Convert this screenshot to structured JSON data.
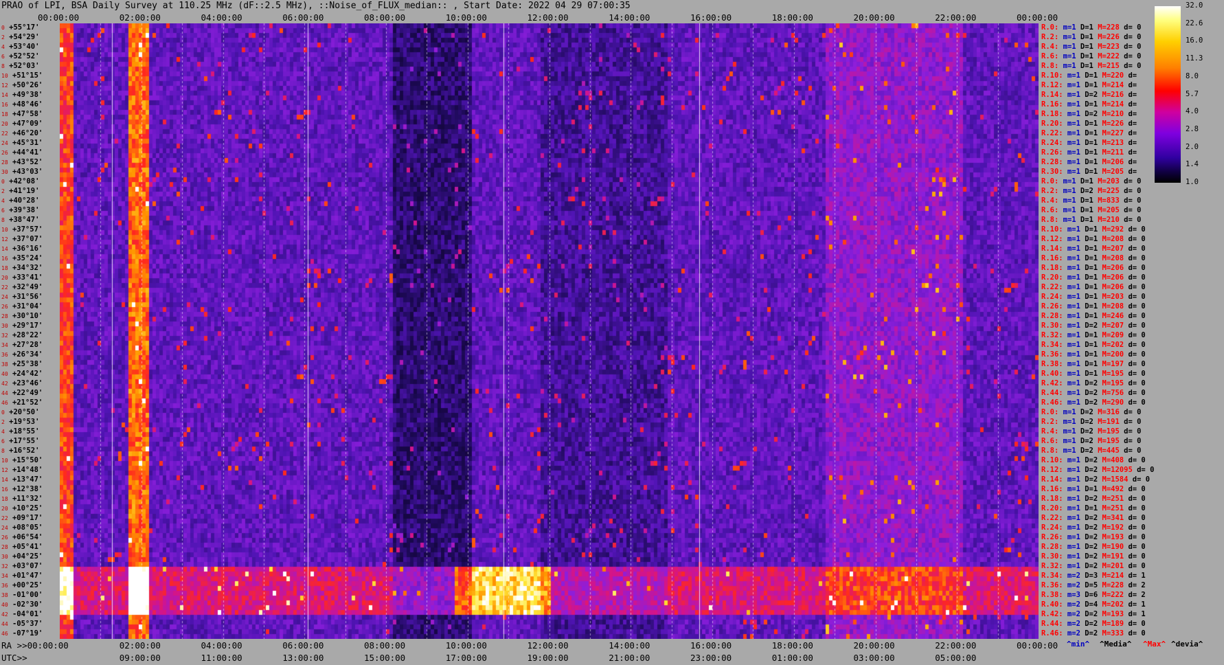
{
  "title": "PRAO of LPI, BSA Daily Survey at 110.25 MHz (dF::2.5 MHz), ::Noise_of_FLUX_median:: , Start Date: 2022 04 29 07:00:35",
  "chart_data": {
    "type": "heatmap",
    "title": "PRAO of LPI, BSA Daily Survey at 110.25 MHz (dF::2.5 MHz), ::Noise_of_FLUX_median:: , Start Date: 2022 04 29 07:00:35",
    "top_axis_ticks": [
      "00:00:00",
      "02:00:00",
      "04:00:00",
      "06:00:00",
      "08:00:00",
      "10:00:00",
      "12:00:00",
      "14:00:00",
      "16:00:00",
      "18:00:00",
      "20:00:00",
      "22:00:00",
      "00:00:00"
    ],
    "ra_axis_label": "RA >>00:00:00",
    "ra_axis_ticks": [
      "02:00:00",
      "04:00:00",
      "06:00:00",
      "08:00:00",
      "10:00:00",
      "12:00:00",
      "14:00:00",
      "16:00:00",
      "18:00:00",
      "20:00:00",
      "22:00:00",
      "00:00:00"
    ],
    "utc_axis_label": "UTC>>",
    "utc_axis_ticks": [
      "09:00:00",
      "11:00:00",
      "13:00:00",
      "15:00:00",
      "17:00:00",
      "19:00:00",
      "21:00:00",
      "23:00:00",
      "01:00:00",
      "03:00:00",
      "05:00:00"
    ],
    "colorbar_ticks": [
      "32.0",
      "22.6",
      "16.0",
      "11.3",
      "8.0",
      "5.7",
      "4.0",
      "2.8",
      "2.0",
      "1.4",
      "1.0"
    ],
    "dec_labels": [
      "+55°17'",
      "+54°29'",
      "+53°40'",
      "+52°52'",
      "+52°03'",
      "+51°15'",
      "+50°26'",
      "+49°38'",
      "+48°46'",
      "+47°58'",
      "+47°09'",
      "+46°20'",
      "+45°31'",
      "+44°41'",
      "+43°52'",
      "+43°03'",
      "+42°08'",
      "+41°19'",
      "+40°28'",
      "+39°38'",
      "+38°47'",
      "+37°57'",
      "+37°07'",
      "+36°16'",
      "+35°24'",
      "+34°32'",
      "+33°41'",
      "+32°49'",
      "+31°56'",
      "+31°04'",
      "+30°10'",
      "+29°17'",
      "+28°22'",
      "+27°28'",
      "+26°34'",
      "+25°38'",
      "+24°42'",
      "+23°46'",
      "+22°49'",
      "+21°52'",
      "+20°50'",
      "+19°53'",
      "+18°55'",
      "+17°55'",
      "+16°52'",
      "+15°50'",
      "+14°48'",
      "+13°47'",
      "+12°38'",
      "+11°32'",
      "+10°25'",
      "+09°17'",
      "+08°05'",
      "+06°54'",
      "+05°41'",
      "+04°25'",
      "+03°07'",
      "+01°47'",
      "+00°25'",
      "-01°00'",
      "-02°30'",
      "-04°01'",
      "-05°37'",
      "-07°19'"
    ],
    "row_numbers": [
      "0",
      "2",
      "4",
      "6",
      "8",
      "10",
      "12",
      "14",
      "16",
      "18",
      "20",
      "22",
      "24",
      "26",
      "28",
      "30",
      "0",
      "2",
      "4",
      "6",
      "8",
      "10",
      "12",
      "14",
      "16",
      "18",
      "20",
      "22",
      "24",
      "26",
      "28",
      "30",
      "32",
      "34",
      "36",
      "38",
      "40",
      "42",
      "44",
      "46",
      "0",
      "2",
      "4",
      "6",
      "8",
      "10",
      "12",
      "14",
      "16",
      "18",
      "20",
      "22",
      "24",
      "26",
      "28",
      "30",
      "32",
      "34",
      "36",
      "38",
      "40",
      "42",
      "44",
      "46"
    ],
    "stats": [
      {
        "r": "R.0:",
        "m": "m=1",
        "D": "D=1",
        "M": "M=228",
        "d": "d= 0"
      },
      {
        "r": "R.2:",
        "m": "m=1",
        "D": "D=1",
        "M": "M=226",
        "d": "d= 0"
      },
      {
        "r": "R.4:",
        "m": "m=1",
        "D": "D=1",
        "M": "M=223",
        "d": "d= 0"
      },
      {
        "r": "R.6:",
        "m": "m=1",
        "D": "D=1",
        "M": "M=222",
        "d": "d= 0"
      },
      {
        "r": "R.8:",
        "m": "m=1",
        "D": "D=1",
        "M": "M=215",
        "d": "d= 0"
      },
      {
        "r": "R.10:",
        "m": "m=1",
        "D": "D=1",
        "M": "M=220",
        "d": "d="
      },
      {
        "r": "R.12:",
        "m": "m=1",
        "D": "D=1",
        "M": "M=214",
        "d": "d="
      },
      {
        "r": "R.14:",
        "m": "m=1",
        "D": "D=2",
        "M": "M=216",
        "d": "d="
      },
      {
        "r": "R.16:",
        "m": "m=1",
        "D": "D=1",
        "M": "M=214",
        "d": "d="
      },
      {
        "r": "R.18:",
        "m": "m=1",
        "D": "D=2",
        "M": "M=210",
        "d": "d="
      },
      {
        "r": "R.20:",
        "m": "m=1",
        "D": "D=1",
        "M": "M=226",
        "d": "d="
      },
      {
        "r": "R.22:",
        "m": "m=1",
        "D": "D=1",
        "M": "M=227",
        "d": "d="
      },
      {
        "r": "R.24:",
        "m": "m=1",
        "D": "D=1",
        "M": "M=213",
        "d": "d="
      },
      {
        "r": "R.26:",
        "m": "m=1",
        "D": "D=1",
        "M": "M=211",
        "d": "d="
      },
      {
        "r": "R.28:",
        "m": "m=1",
        "D": "D=1",
        "M": "M=206",
        "d": "d="
      },
      {
        "r": "R.30:",
        "m": "m=1",
        "D": "D=1",
        "M": "M=205",
        "d": "d="
      },
      {
        "r": "R.0:",
        "m": "m=1",
        "D": "D=1",
        "M": "M=203",
        "d": "d= 0"
      },
      {
        "r": "R.2:",
        "m": "m=1",
        "D": "D=2",
        "M": "M=225",
        "d": "d= 0"
      },
      {
        "r": "R.4:",
        "m": "m=1",
        "D": "D=1",
        "M": "M=833",
        "d": "d= 0"
      },
      {
        "r": "R.6:",
        "m": "m=1",
        "D": "D=1",
        "M": "M=205",
        "d": "d= 0"
      },
      {
        "r": "R.8:",
        "m": "m=1",
        "D": "D=1",
        "M": "M=210",
        "d": "d= 0"
      },
      {
        "r": "R.10:",
        "m": "m=1",
        "D": "D=1",
        "M": "M=292",
        "d": "d= 0"
      },
      {
        "r": "R.12:",
        "m": "m=1",
        "D": "D=1",
        "M": "M=208",
        "d": "d= 0"
      },
      {
        "r": "R.14:",
        "m": "m=1",
        "D": "D=1",
        "M": "M=207",
        "d": "d= 0"
      },
      {
        "r": "R.16:",
        "m": "m=1",
        "D": "D=1",
        "M": "M=208",
        "d": "d= 0"
      },
      {
        "r": "R.18:",
        "m": "m=1",
        "D": "D=1",
        "M": "M=206",
        "d": "d= 0"
      },
      {
        "r": "R.20:",
        "m": "m=1",
        "D": "D=1",
        "M": "M=206",
        "d": "d= 0"
      },
      {
        "r": "R.22:",
        "m": "m=1",
        "D": "D=1",
        "M": "M=206",
        "d": "d= 0"
      },
      {
        "r": "R.24:",
        "m": "m=1",
        "D": "D=1",
        "M": "M=203",
        "d": "d= 0"
      },
      {
        "r": "R.26:",
        "m": "m=1",
        "D": "D=1",
        "M": "M=208",
        "d": "d= 0"
      },
      {
        "r": "R.28:",
        "m": "m=1",
        "D": "D=1",
        "M": "M=246",
        "d": "d= 0"
      },
      {
        "r": "R.30:",
        "m": "m=1",
        "D": "D=2",
        "M": "M=207",
        "d": "d= 0"
      },
      {
        "r": "R.32:",
        "m": "m=1",
        "D": "D=1",
        "M": "M=209",
        "d": "d= 0"
      },
      {
        "r": "R.34:",
        "m": "m=1",
        "D": "D=1",
        "M": "M=202",
        "d": "d= 0"
      },
      {
        "r": "R.36:",
        "m": "m=1",
        "D": "D=1",
        "M": "M=200",
        "d": "d= 0"
      },
      {
        "r": "R.38:",
        "m": "m=1",
        "D": "D=1",
        "M": "M=197",
        "d": "d= 0"
      },
      {
        "r": "R.40:",
        "m": "m=1",
        "D": "D=1",
        "M": "M=195",
        "d": "d= 0"
      },
      {
        "r": "R.42:",
        "m": "m=1",
        "D": "D=2",
        "M": "M=195",
        "d": "d= 0"
      },
      {
        "r": "R.44:",
        "m": "m=1",
        "D": "D=2",
        "M": "M=756",
        "d": "d= 0"
      },
      {
        "r": "R.46:",
        "m": "m=1",
        "D": "D=2",
        "M": "M=290",
        "d": "d= 0"
      },
      {
        "r": "R.0:",
        "m": "m=1",
        "D": "D=2",
        "M": "M=316",
        "d": "d= 0"
      },
      {
        "r": "R.2:",
        "m": "m=1",
        "D": "D=2",
        "M": "M=191",
        "d": "d= 0"
      },
      {
        "r": "R.4:",
        "m": "m=1",
        "D": "D=2",
        "M": "M=195",
        "d": "d= 0"
      },
      {
        "r": "R.6:",
        "m": "m=1",
        "D": "D=2",
        "M": "M=195",
        "d": "d= 0"
      },
      {
        "r": "R.8:",
        "m": "m=1",
        "D": "D=2",
        "M": "M=445",
        "d": "d= 0"
      },
      {
        "r": "R.10:",
        "m": "m=1",
        "D": "D=2",
        "M": "M=408",
        "d": "d= 0"
      },
      {
        "r": "R.12:",
        "m": "m=1",
        "D": "D=2",
        "M": "M=12095",
        "d": "d= 0"
      },
      {
        "r": "R.14:",
        "m": "m=1",
        "D": "D=2",
        "M": "M=1584",
        "d": "d= 0"
      },
      {
        "r": "R.16:",
        "m": "m=1",
        "D": "D=1",
        "M": "M=492",
        "d": "d= 0"
      },
      {
        "r": "R.18:",
        "m": "m=1",
        "D": "D=2",
        "M": "M=251",
        "d": "d= 0"
      },
      {
        "r": "R.20:",
        "m": "m=1",
        "D": "D=1",
        "M": "M=251",
        "d": "d= 0"
      },
      {
        "r": "R.22:",
        "m": "m=1",
        "D": "D=2",
        "M": "M=341",
        "d": "d= 0"
      },
      {
        "r": "R.24:",
        "m": "m=1",
        "D": "D=2",
        "M": "M=192",
        "d": "d= 0"
      },
      {
        "r": "R.26:",
        "m": "m=1",
        "D": "D=2",
        "M": "M=193",
        "d": "d= 0"
      },
      {
        "r": "R.28:",
        "m": "m=1",
        "D": "D=2",
        "M": "M=190",
        "d": "d= 0"
      },
      {
        "r": "R.30:",
        "m": "m=1",
        "D": "D=2",
        "M": "M=191",
        "d": "d= 0"
      },
      {
        "r": "R.32:",
        "m": "m=1",
        "D": "D=2",
        "M": "M=201",
        "d": "d= 0"
      },
      {
        "r": "R.34:",
        "m": "m=2",
        "D": "D=3",
        "M": "M=214",
        "d": "d= 1"
      },
      {
        "r": "R.36:",
        "m": "m=2",
        "D": "D=5",
        "M": "M=228",
        "d": "d= 2"
      },
      {
        "r": "R.38:",
        "m": "m=3",
        "D": "D=6",
        "M": "M=222",
        "d": "d= 2"
      },
      {
        "r": "R.40:",
        "m": "m=2",
        "D": "D=4",
        "M": "M=202",
        "d": "d= 1"
      },
      {
        "r": "R.42:",
        "m": "m=2",
        "D": "D=2",
        "M": "M=193",
        "d": "d= 1"
      },
      {
        "r": "R.44:",
        "m": "m=2",
        "D": "D=2",
        "M": "M=189",
        "d": "d= 0"
      },
      {
        "r": "R.46:",
        "m": "m=2",
        "D": "D=2",
        "M": "M=333",
        "d": "d= 0"
      }
    ],
    "legend": {
      "min": "^min^",
      "media": "^Media^",
      "max": "^Max^",
      "devia": "^devia^"
    },
    "colors": {
      "min": "#0000c0",
      "media": "#000000",
      "max": "#ff0000",
      "devia": "#000000"
    }
  }
}
